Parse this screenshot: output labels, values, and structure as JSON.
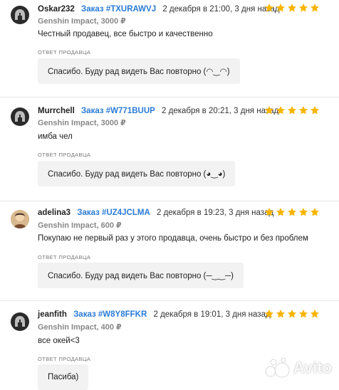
{
  "seller_reply_label": "ОТВЕТ ПРОДАВЦА",
  "order_label": "Заказ",
  "rating": 5,
  "colors": {
    "star": "#f7b500",
    "order_link": "#2a7bd6",
    "reply_bg": "#f2f2f2"
  },
  "reviews": [
    {
      "nick": "Oskar232",
      "order_id": "#TXURAWVJ",
      "date": "2 декабря в 21:00, 3 дня назад",
      "game": "Genshin Impact, 3000 ₽",
      "text": "Честный продавец, все быстро и качественно",
      "reply": "Спасибо. Буду рад видеть Вас повторно (◠‿◠)"
    },
    {
      "nick": "Murrchell",
      "order_id": "#W771BUUP",
      "date": "2 декабря в 20:21, 3 дня назад",
      "game": "Genshin Impact, 3000 ₽",
      "text": "имба чел",
      "reply": "Спасибо. Буду рад видеть Вас повторно (◕‿◕)"
    },
    {
      "nick": "adelina3",
      "order_id": "#UZ4JCLMA",
      "date": "2 декабря в 19:23, 3 дня назад",
      "game": "Genshin Impact, 600 ₽",
      "text": "Покупаю не первый раз у этого продавца, очень быстро и без проблем",
      "reply": "Спасибо. Буду рад видеть Вас повторно (─‿‿─)"
    },
    {
      "nick": "jeanfith",
      "order_id": "#W8Y8FFKR",
      "date": "2 декабря в 19:01, 3 дня назад",
      "game": "Genshin Impact, 400 ₽",
      "text": "все окей<3",
      "reply": "Пасиба)"
    }
  ],
  "watermark": "Avito"
}
